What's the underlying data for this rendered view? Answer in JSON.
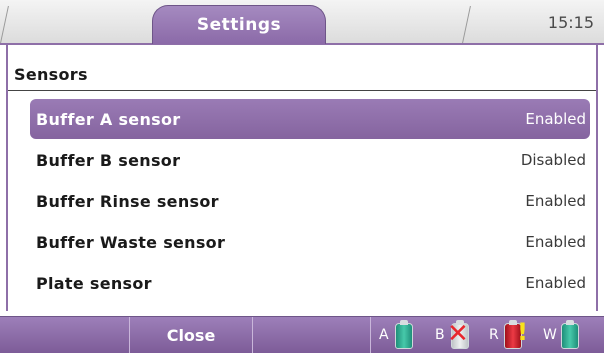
{
  "header": {
    "active_tab": "Settings",
    "time": "15:15"
  },
  "section": {
    "title": "Sensors"
  },
  "sensors": [
    {
      "label": "Buffer A sensor",
      "value": "Enabled",
      "selected": true
    },
    {
      "label": "Buffer B sensor",
      "value": "Disabled",
      "selected": false
    },
    {
      "label": "Buffer Rinse sensor",
      "value": "Enabled",
      "selected": false
    },
    {
      "label": "Buffer Waste sensor",
      "value": "Enabled",
      "selected": false
    },
    {
      "label": "Plate sensor",
      "value": "Enabled",
      "selected": false
    }
  ],
  "footer": {
    "button_left": "",
    "close_label": "Close",
    "button_right": "",
    "bottles": [
      {
        "letter": "A",
        "icon": "bottle-teal-icon",
        "color": "#2aa58d"
      },
      {
        "letter": "B",
        "icon": "bottle-empty-x-icon",
        "color": "#d0d0d0"
      },
      {
        "letter": "R",
        "icon": "bottle-red-warning-icon",
        "color": "#d11c2a"
      },
      {
        "letter": "W",
        "icon": "bottle-teal-icon",
        "color": "#2aa58d"
      }
    ]
  },
  "colors": {
    "accent": "#8e6fa8",
    "selected_row": "#8f6fab"
  }
}
